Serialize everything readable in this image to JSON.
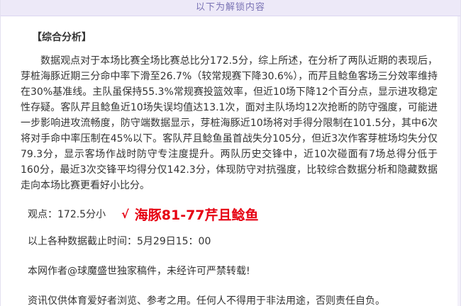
{
  "banner": {
    "text": "以下为解锁内容"
  },
  "section": {
    "title": "【综合分析】"
  },
  "analysis": {
    "text": "数据观点对于本场比赛全场比赛总比分172.5分，综上所述，在分析了两队近期的表现后，芽桩海豚近期三分命中率下滑至26.7%（较常规赛下降30.6%），而芹且鲶鱼客场三分效率维持在30%基准线。主队虽保持55.3%常规赛投篮效率，但近10场下降12个百分点，显示进攻稳定性存疑。客队芹且鲶鱼近10场失误均值达13.1次，面对主队场均12次抢断的防守强度，可能进一步影响进攻流畅度，防守端数据显示，芽桩海豚近10场将对手得分限制在101.5分，其中6次将对手命中率压制在45%以下。客队芹且鲶鱼虽首战失分105分，但近3次作客芽桩场均失分仅79.3分，显示客场作战时防守专注度提升。两队历史交锋中，近10次碰面有7场总得分低于160分，最近3次交锋平均得分仅142.3分，体现防守对抗强度，比较综合数据分析和隐藏数据走向本场比赛更看好小比分。"
  },
  "verdict": {
    "label": "观点：172.5分小",
    "check": "√",
    "pick": "海豚81-77芹且鲶鱼",
    "check_color": "#e60012"
  },
  "cutoff": {
    "text": "以上各种数据截止时间：5月29日15：00"
  },
  "copyright": {
    "text": "本网作者@球魔盛世独家稿件，未经许可严禁转载!"
  },
  "disclaimer": {
    "text": "资讯仅供体育爱好者浏览、参考之用。任何人不得用于非法用途，否则责任自负。"
  }
}
